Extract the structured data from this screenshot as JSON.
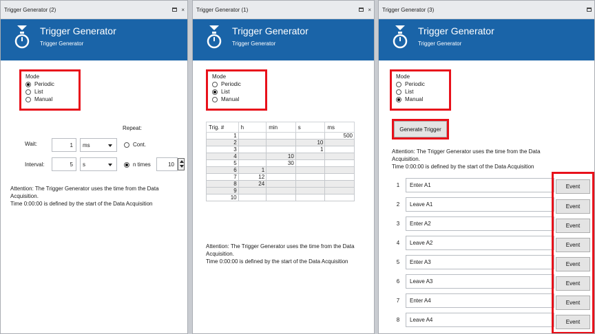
{
  "app_header": {
    "title": "Trigger Generator",
    "subtitle": "Trigger Generator"
  },
  "mode": {
    "label": "Mode",
    "options": [
      "Periodic",
      "List",
      "Manual"
    ]
  },
  "panel_periodic": {
    "window_title": "Trigger Generator (2)",
    "selected_mode": "Periodic",
    "repeat_label": "Repeat:",
    "wait_label": "Wait:",
    "wait_value": "1",
    "wait_unit": "ms",
    "cont_label": "Cont.",
    "interval_label": "Interval:",
    "interval_value": "5",
    "interval_unit": "s",
    "ntimes_label": "n times",
    "ntimes_value": "10",
    "repeat_selected": "n times",
    "attention_line1": "Attention: The Trigger Generator uses the time from the Data",
    "attention_line2": "Acquisition.",
    "attention_line3": "Time 0:00:00 is defined by the start of the Data Acquisition"
  },
  "panel_list": {
    "window_title": "Trigger Generator (1)",
    "selected_mode": "List",
    "columns": [
      "Trig. #",
      "h",
      "min",
      "s",
      "ms"
    ],
    "rows": [
      [
        "1",
        "",
        "",
        "",
        "500"
      ],
      [
        "2",
        "",
        "",
        "10",
        ""
      ],
      [
        "3",
        "",
        "",
        "1",
        ""
      ],
      [
        "4",
        "",
        "10",
        "",
        ""
      ],
      [
        "5",
        "",
        "30",
        "",
        ""
      ],
      [
        "6",
        "1",
        "",
        "",
        ""
      ],
      [
        "7",
        "12",
        "",
        "",
        ""
      ],
      [
        "8",
        "24",
        "",
        "",
        ""
      ],
      [
        "9",
        "",
        "",
        "",
        ""
      ],
      [
        "10",
        "",
        "",
        "",
        ""
      ]
    ],
    "attention_line1": "Attention: The Trigger Generator uses the time from the Data",
    "attention_line2": "Acquisition.",
    "attention_line3": "Time 0:00:00 is defined by the start of the Data Acquisition"
  },
  "panel_manual": {
    "window_title": "Trigger Generator (3)",
    "selected_mode": "Manual",
    "generate_label": "Generate Trigger",
    "attention_line1": "Attention: The Trigger Generator uses the time from the Data",
    "attention_line2": "Acquisition.",
    "attention_line3": "Time 0:00:00 is defined by the start of the Data Acquisition",
    "event_button_label": "Event",
    "events": [
      {
        "index": "1",
        "name": "Enter A1"
      },
      {
        "index": "2",
        "name": "Leave A1"
      },
      {
        "index": "3",
        "name": "Enter A2"
      },
      {
        "index": "4",
        "name": "Leave A2"
      },
      {
        "index": "5",
        "name": "Enter A3"
      },
      {
        "index": "6",
        "name": "Leave A3"
      },
      {
        "index": "7",
        "name": "Enter A4"
      },
      {
        "index": "8",
        "name": "Leave A4"
      }
    ]
  },
  "titlebar_icons": {
    "restore": "restore-icon",
    "close": "close-icon",
    "close_glyph": "×"
  },
  "colors": {
    "header_blue": "#1a64a8",
    "highlight_red": "#e8101a",
    "window_bg": "#ffffff"
  }
}
